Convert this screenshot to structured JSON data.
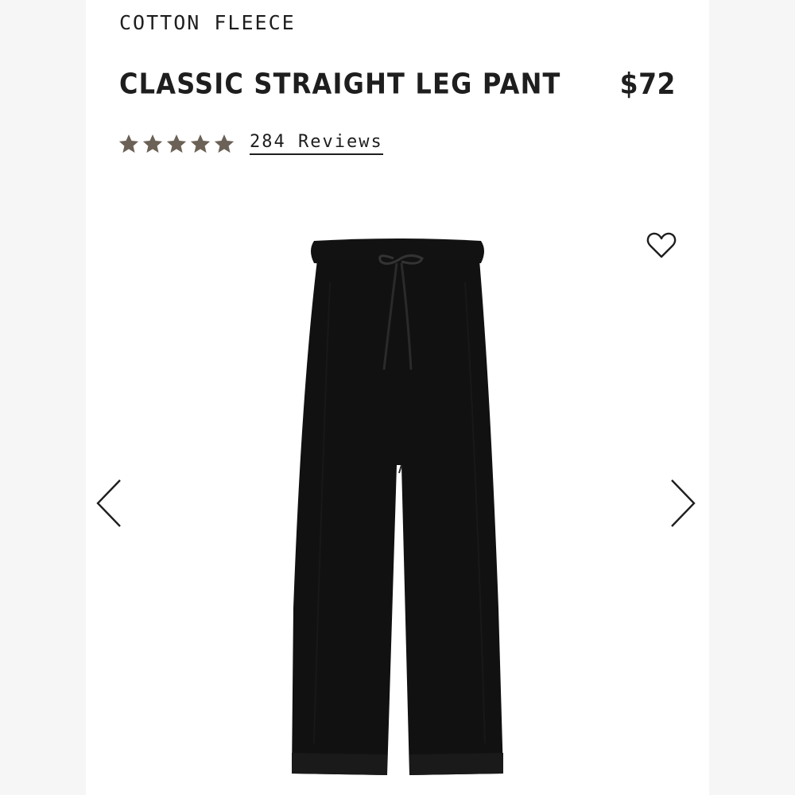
{
  "product": {
    "collection": "COTTON FLEECE",
    "title": "CLASSIC STRAIGHT LEG PANT",
    "price": "$72",
    "rating": {
      "stars": 5,
      "max_stars": 5,
      "reviews_label": "284 Reviews",
      "star_color": "#6b6156"
    }
  },
  "gallery": {
    "image_subject": "black straight leg pant with drawstring waist",
    "wishlist_icon": "heart-outline-icon",
    "prev_icon": "chevron-left-icon",
    "next_icon": "chevron-right-icon"
  },
  "colors": {
    "text": "#1e1e1e",
    "background": "#ffffff",
    "product": "#111111"
  }
}
